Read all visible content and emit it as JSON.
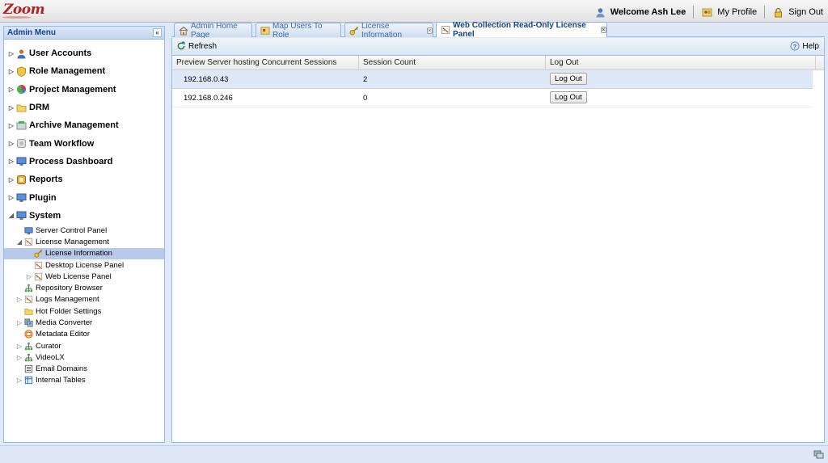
{
  "app": {
    "logo_text": "Zoom",
    "welcome": "Welcome Ash Lee",
    "my_profile": "My Profile",
    "sign_out": "Sign Out"
  },
  "sidebar": {
    "title": "Admin Menu",
    "collapse_glyph": "«",
    "items": [
      {
        "label": "User Accounts",
        "icon": "users-icon"
      },
      {
        "label": "Role Management",
        "icon": "shield-icon"
      },
      {
        "label": "Project Management",
        "icon": "pie-icon"
      },
      {
        "label": "DRM",
        "icon": "folder-icon"
      },
      {
        "label": "Archive Management",
        "icon": "archive-icon"
      },
      {
        "label": "Team Workflow",
        "icon": "workflow-icon"
      },
      {
        "label": "Process Dashboard",
        "icon": "monitor-icon"
      },
      {
        "label": "Reports",
        "icon": "reports-icon"
      },
      {
        "label": "Plugin",
        "icon": "monitor-icon"
      },
      {
        "label": "System",
        "icon": "monitor-icon"
      }
    ],
    "system_children": [
      {
        "label": "Server Control Panel",
        "icon": "monitor-icon"
      },
      {
        "label": "License Management",
        "icon": "certificate-icon"
      },
      {
        "label": "License Information",
        "icon": "key-icon"
      },
      {
        "label": "Desktop License Panel",
        "icon": "certificate-icon"
      },
      {
        "label": "Web License Panel",
        "icon": "certificate-icon"
      },
      {
        "label": "Repository Browser",
        "icon": "tree-icon"
      },
      {
        "label": "Logs Management",
        "icon": "certificate-icon"
      },
      {
        "label": "Hot Folder Settings",
        "icon": "folder-icon"
      },
      {
        "label": "Media Converter",
        "icon": "converter-icon"
      },
      {
        "label": "Metadata Editor",
        "icon": "editor-icon"
      },
      {
        "label": "Curator",
        "icon": "tree-icon"
      },
      {
        "label": "VideoLX",
        "icon": "tree-icon"
      },
      {
        "label": "Email Domains",
        "icon": "list-icon"
      },
      {
        "label": "Internal Tables",
        "icon": "table-icon"
      }
    ]
  },
  "tabs": [
    {
      "label": "Admin Home Page",
      "icon": "home-icon"
    },
    {
      "label": "Map Users To Role",
      "icon": "map-users-icon"
    },
    {
      "label": "License Information",
      "icon": "key-icon"
    },
    {
      "label": "Web Collection Read-Only License Panel",
      "icon": "certificate-icon",
      "active": true
    }
  ],
  "tab_close_glyph": "×",
  "toolbar": {
    "refresh": "Refresh",
    "help": "Help"
  },
  "grid": {
    "columns": [
      "Preview Server hosting Concurrent Sessions",
      "Session Count",
      "Log Out"
    ],
    "rows": [
      {
        "server": "192.168.0.43",
        "count": "2",
        "action": "Log Out"
      },
      {
        "server": "192.168.0.246",
        "count": "0",
        "action": "Log Out"
      }
    ]
  },
  "colors": {
    "accent": "#15428b",
    "panel_border": "#99bbe8",
    "selection": "#b8c9ea"
  }
}
